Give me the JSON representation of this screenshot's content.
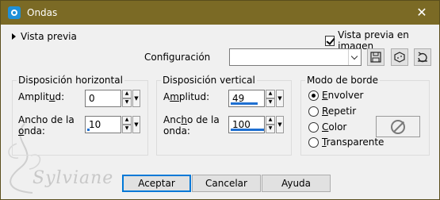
{
  "window": {
    "title": "Ondas",
    "close_glyph": "✕"
  },
  "preview": {
    "toggle_label": "Vista previa",
    "checkbox_label": "Vista previa en imagen",
    "checked": true
  },
  "config": {
    "label": "Configuración",
    "value": ""
  },
  "toolbar_icons": [
    "save-icon",
    "dice-icon",
    "reset-icon"
  ],
  "horizontal": {
    "title": "Disposición horizontal",
    "amplitude_label_pre": "Amplit",
    "amplitude_label_u": "u",
    "amplitude_label_post": "d:",
    "amplitude_value": "0",
    "wavelength_label_1": "Ancho de la",
    "wavelength_label_2_u": "o",
    "wavelength_label_2_post": "nda:",
    "wavelength_value": "10"
  },
  "vertical": {
    "title": "Disposición vertical",
    "amplitude_label_pre": "A",
    "amplitude_label_u": "m",
    "amplitude_label_post": "plitud:",
    "amplitude_value": "49",
    "wavelength_label_1_pre": "Anc",
    "wavelength_label_1_u": "h",
    "wavelength_label_1_post": "o de la",
    "wavelength_label_2": "onda:",
    "wavelength_value": "100"
  },
  "edge_mode": {
    "title": "Modo de borde",
    "options": [
      {
        "u": "E",
        "rest": "nvolver",
        "selected": true
      },
      {
        "u": "R",
        "rest": "epetir",
        "selected": false
      },
      {
        "u": "C",
        "rest": "olor",
        "selected": false
      },
      {
        "u": "T",
        "rest": "ransparente",
        "selected": false
      }
    ]
  },
  "buttons": {
    "ok": "Aceptar",
    "cancel": "Cancelar",
    "help": "Ayuda"
  },
  "watermark_text": "Sylviane",
  "colors": {
    "titlebar": "#7b6a25",
    "accent": "#1e6fd1"
  }
}
